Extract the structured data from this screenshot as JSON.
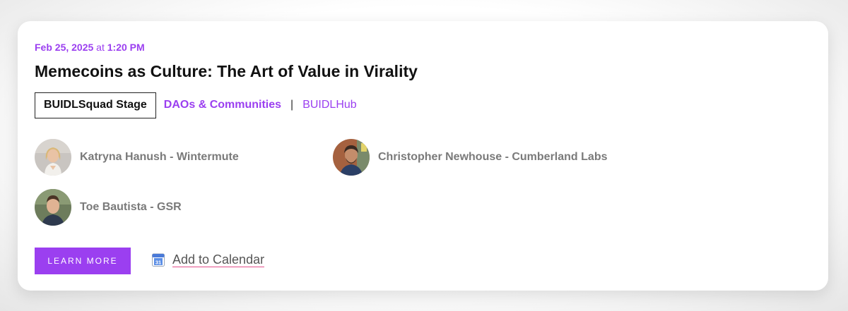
{
  "event": {
    "date": "Feb 25, 2025",
    "at": "at",
    "time": "1:20 PM",
    "title": "Memecoins as Culture: The Art of Value in Virality",
    "stage": "BUIDLSquad Stage",
    "track": "DAOs & Communities",
    "separator": "|",
    "venue": "BUIDLHub"
  },
  "speakers": [
    {
      "name": "Katryna Hanush - Wintermute"
    },
    {
      "name": "Christopher Newhouse - Cumberland Labs"
    },
    {
      "name": "Toe Bautista - GSR"
    }
  ],
  "actions": {
    "learn_more": "LEARN MORE",
    "add_to_calendar": "Add to Calendar",
    "calendar_icon_day": "31"
  },
  "colors": {
    "accent": "#9b3ff0",
    "title": "#111111",
    "speaker_text": "#7a7a7a",
    "calendar_underline": "#e44d8a"
  },
  "icons": {
    "calendar": "calendar-icon"
  }
}
